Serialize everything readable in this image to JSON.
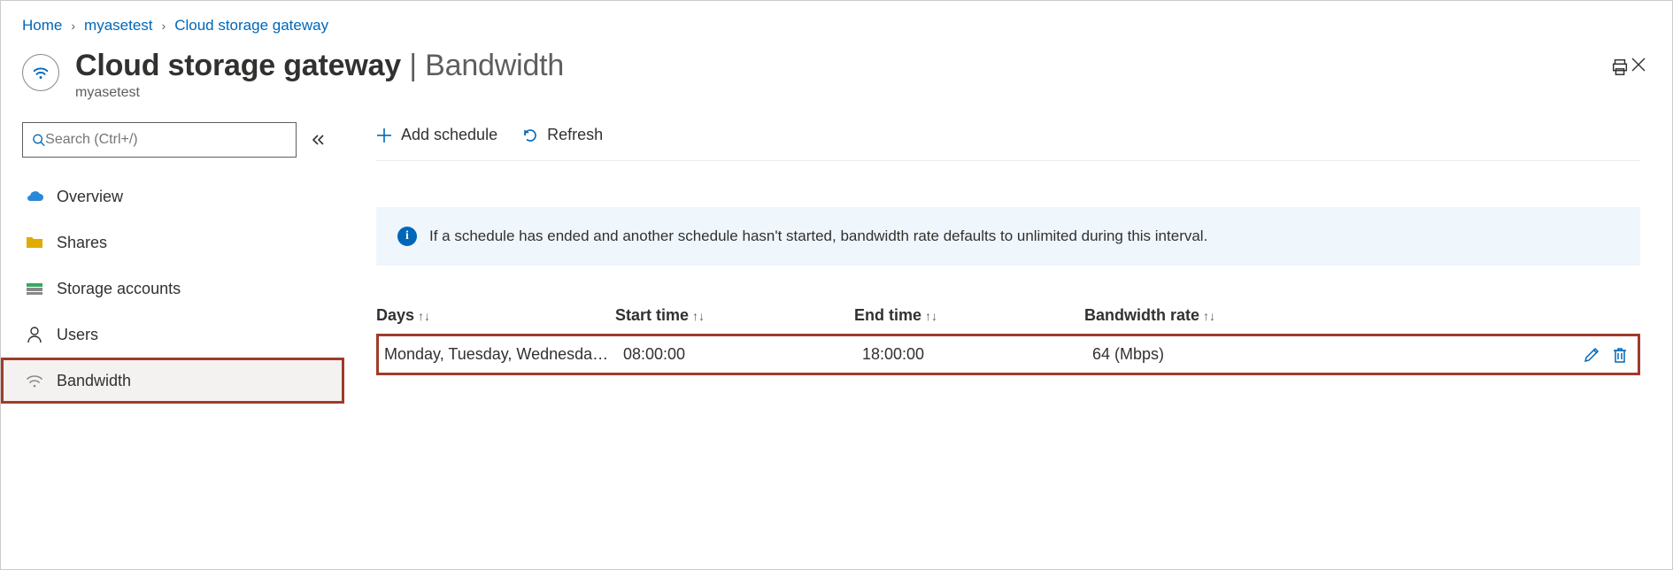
{
  "breadcrumb": {
    "home": "Home",
    "resource": "myasetest",
    "page": "Cloud storage gateway"
  },
  "header": {
    "title": "Cloud storage gateway",
    "section": "Bandwidth",
    "resource_name": "myasetest"
  },
  "search": {
    "placeholder": "Search (Ctrl+/)"
  },
  "sidebar": {
    "items": [
      {
        "label": "Overview"
      },
      {
        "label": "Shares"
      },
      {
        "label": "Storage accounts"
      },
      {
        "label": "Users"
      },
      {
        "label": "Bandwidth"
      }
    ]
  },
  "toolbar": {
    "add_label": "Add schedule",
    "refresh_label": "Refresh"
  },
  "info": {
    "text": "If a schedule has ended and another schedule hasn't started, bandwidth rate defaults to unlimited during this interval."
  },
  "table": {
    "columns": {
      "days": "Days",
      "start": "Start time",
      "end": "End time",
      "rate": "Bandwidth rate"
    },
    "rows": [
      {
        "days": "Monday, Tuesday, Wednesday, Thursday, Friday",
        "start": "08:00:00",
        "end": "18:00:00",
        "rate": "64 (Mbps)"
      }
    ]
  }
}
